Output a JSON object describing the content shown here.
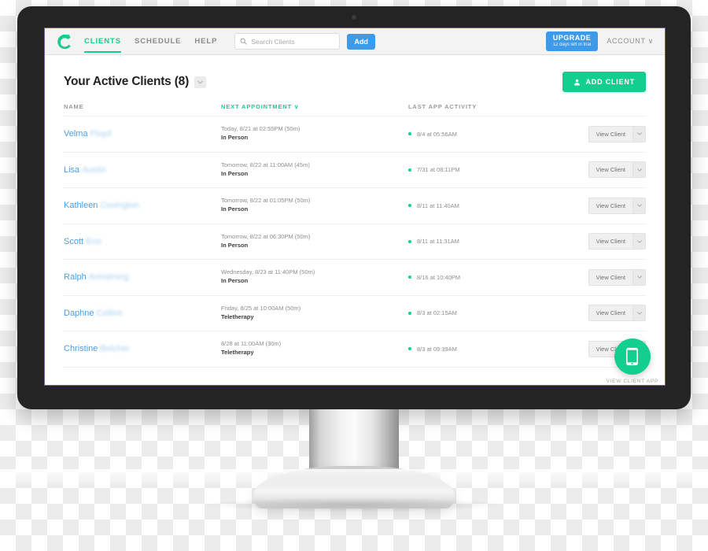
{
  "nav": {
    "logo_icon": "c-logo-icon",
    "links": [
      {
        "label": "CLIENTS",
        "active": true
      },
      {
        "label": "SCHEDULE",
        "active": false
      },
      {
        "label": "HELP",
        "active": false
      }
    ],
    "search": {
      "placeholder": "Search Clients",
      "value": "",
      "icon": "search-icon"
    },
    "add_label": "Add",
    "upgrade": {
      "title": "UPGRADE",
      "subtitle": "12 days left in trial"
    },
    "account": {
      "label": "ACCOUNT",
      "caret_icon": "chevron-down-icon"
    }
  },
  "page": {
    "title": "Your Active Clients (8)",
    "title_caret_icon": "chevron-down-icon",
    "add_client": {
      "label": "ADD CLIENT",
      "icon": "person-icon"
    }
  },
  "table": {
    "headers": {
      "name": "NAME",
      "next_appointment": "NEXT APPOINTMENT",
      "next_appointment_sorted": true,
      "sort_caret_icon": "chevron-down-icon",
      "last_activity": "LAST APP ACTIVITY"
    },
    "row_action": {
      "label": "View Client",
      "caret_icon": "chevron-down-icon"
    },
    "rows": [
      {
        "first_name": "Velma",
        "last_name": "Floyd",
        "appointment": "Today, 8/21 at 02:55PM (50m)",
        "type": "In Person",
        "activity": "8/4 at 05:56AM",
        "activity_status": "active"
      },
      {
        "first_name": "Lisa",
        "last_name": "Austin",
        "appointment": "Tomorrow, 8/22 at 11:00AM (45m)",
        "type": "In Person",
        "activity": "7/31 at 08:11PM",
        "activity_status": "active"
      },
      {
        "first_name": "Kathleen",
        "last_name": "Covington",
        "appointment": "Tomorrow, 8/22 at 01:05PM (50m)",
        "type": "In Person",
        "activity": "8/11 at 11:40AM",
        "activity_status": "active"
      },
      {
        "first_name": "Scott",
        "last_name": "Eno",
        "appointment": "Tomorrow, 8/22 at 06:30PM (50m)",
        "type": "In Person",
        "activity": "8/11 at 11:31AM",
        "activity_status": "active"
      },
      {
        "first_name": "Ralph",
        "last_name": "Armstrong",
        "appointment": "Wednesday, 8/23 at 11:40PM (50m)",
        "type": "In Person",
        "activity": "8/16 at 10:40PM",
        "activity_status": "active"
      },
      {
        "first_name": "Daphne",
        "last_name": "Collins",
        "appointment": "Friday, 8/25 at 10:00AM (50m)",
        "type": "Teletherapy",
        "activity": "8/3 at 02:15AM",
        "activity_status": "active"
      },
      {
        "first_name": "Christine",
        "last_name": "Belcher",
        "appointment": "8/28 at 11:00AM (30m)",
        "type": "Teletherapy",
        "activity": "8/3 at 09:39AM",
        "activity_status": "active"
      }
    ]
  },
  "fab": {
    "label": "VIEW CLIENT APP",
    "icon": "mobile-phone-icon"
  },
  "colors": {
    "brand_green": "#13cf8f",
    "accent_blue": "#3d9ae8",
    "link_blue": "#4a9fe0",
    "bezel": "#242424",
    "nav_bg": "#f3f3f3",
    "viewport_border": "#7b5ea7"
  }
}
